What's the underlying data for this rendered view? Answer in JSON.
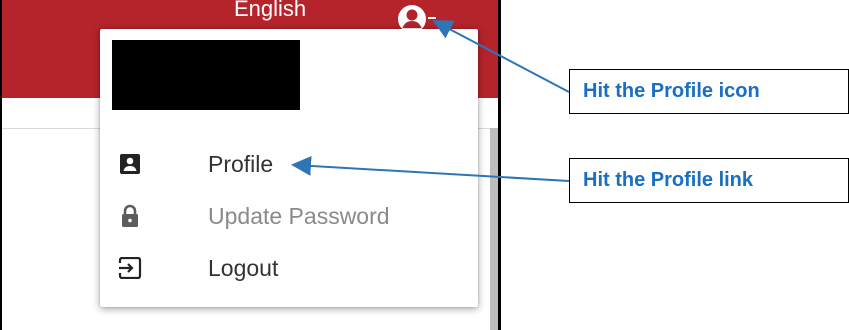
{
  "header": {
    "language_label": "English",
    "icon": "account-circle-icon",
    "caret_icon": "caret-down-icon"
  },
  "dropdown": {
    "items": [
      {
        "label": "Profile",
        "icon": "badge-icon",
        "enabled": true
      },
      {
        "label": "Update Password",
        "icon": "lock-icon",
        "enabled": false
      },
      {
        "label": "Logout",
        "icon": "logout-icon",
        "enabled": true
      }
    ]
  },
  "annotations": {
    "callout_profile_icon": "Hit the Profile icon",
    "callout_profile_link": "Hit the Profile link"
  },
  "colors": {
    "header_red": "#b5232b",
    "annotation_blue": "#1a6fc2",
    "arrow_blue": "#2e75b6"
  }
}
